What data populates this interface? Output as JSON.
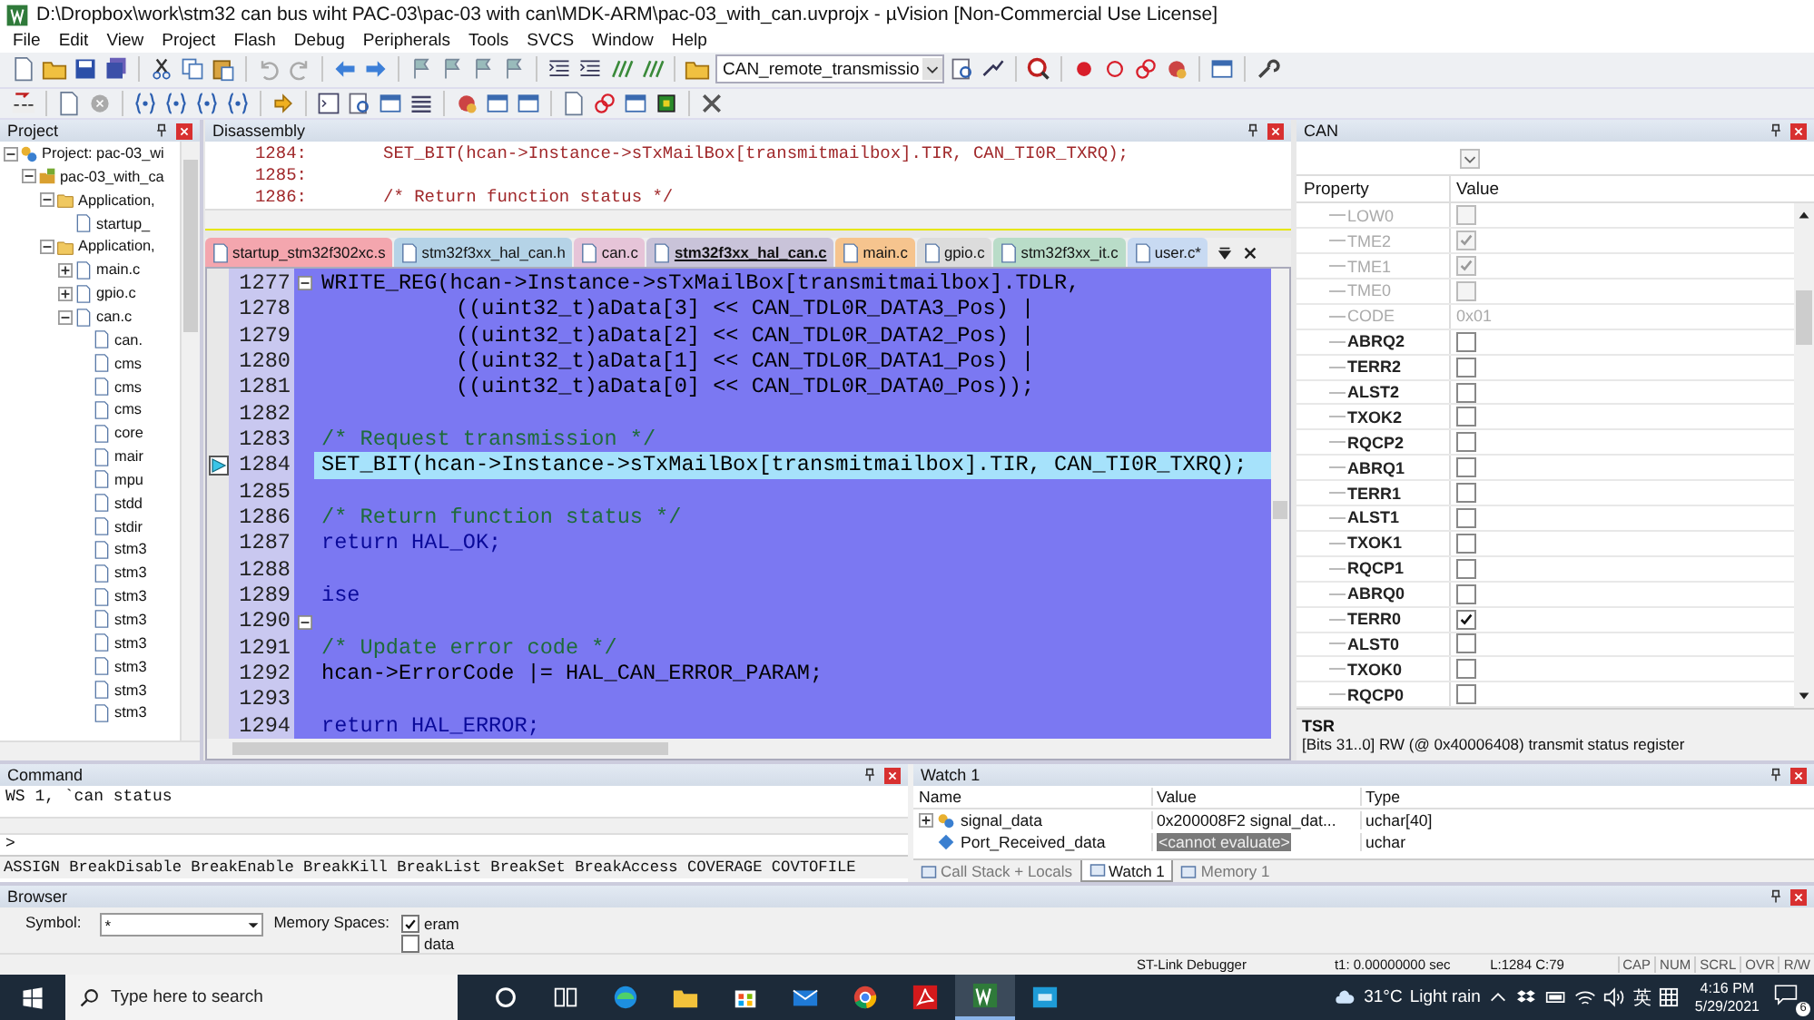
{
  "window": {
    "title": "D:\\Dropbox\\work\\stm32 can bus wiht PAC-03\\pac-03 with can\\MDK-ARM\\pac-03_with_can.uvprojx - µVision  [Non-Commercial Use License]"
  },
  "menu": [
    "File",
    "Edit",
    "View",
    "Project",
    "Flash",
    "Debug",
    "Peripherals",
    "Tools",
    "SVCS",
    "Window",
    "Help"
  ],
  "toolbar": {
    "target_combo": "CAN_remote_transmissio"
  },
  "project": {
    "title": "Project",
    "tree": [
      {
        "label": "Project: pac-03_wi",
        "kind": "project",
        "expanded": true,
        "children": [
          {
            "label": "pac-03_with_ca",
            "kind": "target",
            "expanded": true,
            "children": [
              {
                "label": "Application,",
                "kind": "folder",
                "expanded": true,
                "children": [
                  {
                    "label": "startup_",
                    "kind": "file"
                  }
                ]
              },
              {
                "label": "Application,",
                "kind": "folder",
                "expanded": true,
                "children": [
                  {
                    "label": "main.c",
                    "kind": "file",
                    "expanded": false
                  },
                  {
                    "label": "gpio.c",
                    "kind": "file",
                    "expanded": false
                  },
                  {
                    "label": "can.c",
                    "kind": "file",
                    "expanded": true,
                    "children": [
                      {
                        "label": "can.",
                        "kind": "file"
                      },
                      {
                        "label": "cms",
                        "kind": "file"
                      },
                      {
                        "label": "cms",
                        "kind": "file"
                      },
                      {
                        "label": "cms",
                        "kind": "file"
                      },
                      {
                        "label": "core",
                        "kind": "file"
                      },
                      {
                        "label": "mair",
                        "kind": "file"
                      },
                      {
                        "label": "mpu",
                        "kind": "file"
                      },
                      {
                        "label": "stdd",
                        "kind": "file"
                      },
                      {
                        "label": "stdir",
                        "kind": "file"
                      },
                      {
                        "label": "stm3",
                        "kind": "file"
                      },
                      {
                        "label": "stm3",
                        "kind": "file"
                      },
                      {
                        "label": "stm3",
                        "kind": "file"
                      },
                      {
                        "label": "stm3",
                        "kind": "file"
                      },
                      {
                        "label": "stm3",
                        "kind": "file"
                      },
                      {
                        "label": "stm3",
                        "kind": "file"
                      },
                      {
                        "label": "stm3",
                        "kind": "file"
                      },
                      {
                        "label": "stm3",
                        "kind": "file"
                      }
                    ]
                  }
                ]
              }
            ]
          }
        ]
      }
    ]
  },
  "disassembly": {
    "title": "Disassembly",
    "lines": [
      {
        "address": "1284:",
        "text": "SET_BIT(hcan->Instance->sTxMailBox[transmitmailbox].TIR, CAN_TI0R_TXRQ);"
      },
      {
        "address": "1285:"
      },
      {
        "address": "1286:",
        "text": "/* Return function status */"
      }
    ]
  },
  "editor": {
    "tabs": [
      {
        "label": "startup_stm32f302xc.s",
        "color": "#f4a6ae",
        "selected": false
      },
      {
        "label": "stm32f3xx_hal_can.h",
        "color": "#b5d3e7",
        "selected": false
      },
      {
        "label": "can.c",
        "color": "#e6c4d8",
        "selected": false
      },
      {
        "label": "stm32f3xx_hal_can.c",
        "color": "#c9c3d9",
        "selected": true
      },
      {
        "label": "main.c",
        "color": "#f6c48e",
        "selected": false
      },
      {
        "label": "gpio.c",
        "color": "#dcdcdc",
        "selected": false
      },
      {
        "label": "stm32f3xx_it.c",
        "color": "#b9dcc8",
        "selected": false
      },
      {
        "label": "user.c*",
        "color": "#c8daf2",
        "selected": false
      }
    ],
    "lines": [
      {
        "number": "1277",
        "text": "WRITE_REG(hcan->Instance->sTxMailBox[transmitmailbox].TDLR,",
        "kind": "code",
        "fold": true,
        "current": false
      },
      {
        "number": "1278",
        "text": "((uint32_t)aData[3] << CAN_TDL0R_DATA3_Pos) |",
        "kind": "continuation",
        "fold": false,
        "current": false
      },
      {
        "number": "1279",
        "text": "((uint32_t)aData[2] << CAN_TDL0R_DATA2_Pos) |",
        "kind": "continuation",
        "fold": false,
        "current": false
      },
      {
        "number": "1280",
        "text": "((uint32_t)aData[1] << CAN_TDL0R_DATA1_Pos) |",
        "kind": "continuation",
        "fold": false,
        "current": false
      },
      {
        "number": "1281",
        "text": "((uint32_t)aData[0] << CAN_TDL0R_DATA0_Pos));",
        "kind": "continuation",
        "fold": false,
        "current": false
      },
      {
        "number": "1282",
        "kind": "code",
        "fold": false,
        "current": false
      },
      {
        "number": "1283",
        "text": "/* Request transmission */",
        "kind": "comment",
        "fold": false,
        "current": false
      },
      {
        "number": "1284",
        "text": "SET_BIT(hcan->Instance->sTxMailBox[transmitmailbox].TIR, CAN_TI0R_TXRQ);",
        "kind": "code",
        "fold": false,
        "current": true
      },
      {
        "number": "1285",
        "kind": "code",
        "fold": false,
        "current": false
      },
      {
        "number": "1286",
        "text": "/* Return function status */",
        "kind": "comment",
        "fold": false,
        "current": false
      },
      {
        "number": "1287",
        "text": "return HAL_OK;",
        "kind": "keyword",
        "fold": false,
        "current": false
      },
      {
        "number": "1288",
        "kind": "code",
        "fold": false,
        "current": false
      },
      {
        "number": "1289",
        "text": "ise",
        "kind": "keyword",
        "fold": false,
        "current": false
      },
      {
        "number": "1290",
        "kind": "code",
        "fold": true,
        "current": false
      },
      {
        "number": "1291",
        "text": "/* Update error code */",
        "kind": "comment",
        "fold": false,
        "current": false
      },
      {
        "number": "1292",
        "text": "hcan->ErrorCode |= HAL_CAN_ERROR_PARAM;",
        "kind": "code",
        "fold": false,
        "current": false
      },
      {
        "number": "1293",
        "kind": "code",
        "fold": false,
        "current": false
      },
      {
        "number": "1294",
        "text": "return HAL_ERROR;",
        "kind": "keyword",
        "fold": false,
        "current": false
      }
    ]
  },
  "can": {
    "title": "CAN",
    "columns": [
      "Property",
      "Value"
    ],
    "rows": [
      {
        "name": "LOW0",
        "kind": "checkbox",
        "checked": false,
        "disabled": true
      },
      {
        "name": "TME2",
        "kind": "checkbox",
        "checked": true,
        "disabled": true
      },
      {
        "name": "TME1",
        "kind": "checkbox",
        "checked": true,
        "disabled": true
      },
      {
        "name": "TME0",
        "kind": "checkbox",
        "checked": false,
        "disabled": true
      },
      {
        "name": "CODE",
        "kind": "value",
        "value": "0x01",
        "disabled": true
      },
      {
        "name": "ABRQ2",
        "kind": "checkbox",
        "checked": false,
        "disabled": false
      },
      {
        "name": "TERR2",
        "kind": "checkbox",
        "checked": false,
        "disabled": false
      },
      {
        "name": "ALST2",
        "kind": "checkbox",
        "checked": false,
        "disabled": false
      },
      {
        "name": "TXOK2",
        "kind": "checkbox",
        "checked": false,
        "disabled": false
      },
      {
        "name": "RQCP2",
        "kind": "checkbox",
        "checked": false,
        "disabled": false
      },
      {
        "name": "ABRQ1",
        "kind": "checkbox",
        "checked": false,
        "disabled": false
      },
      {
        "name": "TERR1",
        "kind": "checkbox",
        "checked": false,
        "disabled": false
      },
      {
        "name": "ALST1",
        "kind": "checkbox",
        "checked": false,
        "disabled": false
      },
      {
        "name": "TXOK1",
        "kind": "checkbox",
        "checked": false,
        "disabled": false
      },
      {
        "name": "RQCP1",
        "kind": "checkbox",
        "checked": false,
        "disabled": false
      },
      {
        "name": "ABRQ0",
        "kind": "checkbox",
        "checked": false,
        "disabled": false
      },
      {
        "name": "TERR0",
        "kind": "checkbox",
        "checked": true,
        "disabled": false
      },
      {
        "name": "ALST0",
        "kind": "checkbox",
        "checked": false,
        "disabled": false
      },
      {
        "name": "TXOK0",
        "kind": "checkbox",
        "checked": false,
        "disabled": false
      },
      {
        "name": "RQCP0",
        "kind": "checkbox",
        "checked": false,
        "disabled": false
      }
    ],
    "info": {
      "title": "TSR",
      "text": "[Bits 31..0] RW (@ 0x40006408) transmit status register"
    }
  },
  "command": {
    "title": "Command",
    "output": "WS 1, `can status",
    "prompt": ">",
    "hint": "ASSIGN BreakDisable BreakEnable BreakKill BreakList BreakSet BreakAccess COVERAGE COVTOFILE"
  },
  "watch": {
    "title": "Watch 1",
    "columns": [
      "Name",
      "Value",
      "Type"
    ],
    "rows": [
      {
        "name": "signal_data",
        "value": "0x200008F2 signal_dat...",
        "type": "uchar[40]",
        "kind": "struct"
      },
      {
        "name": "Port_Received_data",
        "value": "<cannot evaluate>",
        "type": "uchar",
        "kind": "scalar"
      }
    ],
    "tabs": [
      {
        "label": "Call Stack + Locals",
        "selected": false
      },
      {
        "label": "Watch 1",
        "selected": true
      },
      {
        "label": "Memory 1",
        "selected": false
      }
    ]
  },
  "browser": {
    "title": "Browser",
    "symbol_label": "Symbol:",
    "symbol": "*",
    "memory_label": "Memory Spaces:",
    "spaces": [
      {
        "label": "eram",
        "checked": true
      },
      {
        "label": "data",
        "checked": false
      }
    ]
  },
  "status_bar": {
    "items": [
      "ST-Link Debugger",
      "t1: 0.00000000 sec",
      "L:1284 C:79"
    ],
    "indicators": [
      "CAP",
      "NUM",
      "SCRL",
      "OVR",
      "R/W"
    ]
  },
  "taskbar": {
    "search_placeholder": "Type here to search",
    "apps": [
      {
        "kind": "cortana",
        "selected": false
      },
      {
        "kind": "task-view",
        "selected": false
      },
      {
        "kind": "edge",
        "selected": false
      },
      {
        "kind": "explorer",
        "selected": false
      },
      {
        "kind": "store",
        "selected": false
      },
      {
        "kind": "mail",
        "selected": false
      },
      {
        "kind": "chrome",
        "selected": false
      },
      {
        "kind": "acrobat",
        "selected": false
      },
      {
        "kind": "keil",
        "selected": true
      },
      {
        "kind": "cubemx",
        "selected": false
      }
    ],
    "temperature": "31°C",
    "weather": "Light rain",
    "ime": "英",
    "time": "4:16 PM",
    "date": "5/29/2021",
    "notifications": "6"
  }
}
